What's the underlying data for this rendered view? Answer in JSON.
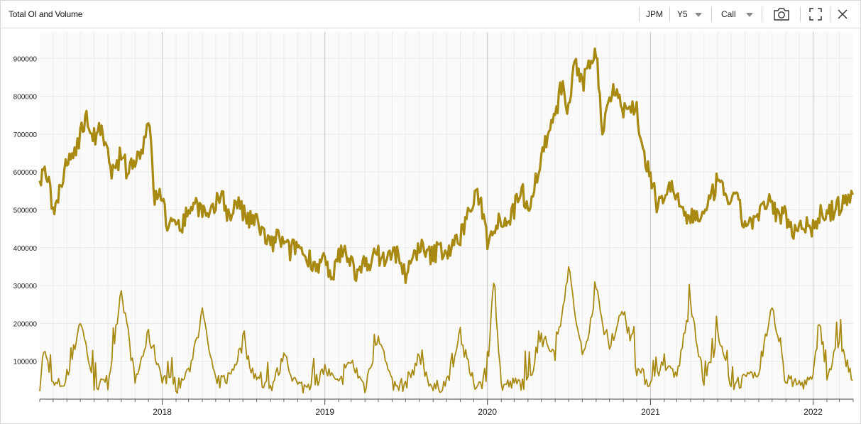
{
  "header": {
    "title": "Total OI and Volume",
    "ticker": "JPM",
    "period": "Y5",
    "option_type": "Call"
  },
  "icons": [
    "camera-icon",
    "fullscreen-icon",
    "close-icon",
    "chevron-down-icon"
  ],
  "colors": {
    "series": "#A88A12",
    "grid": "#ececec",
    "year_line": "#c8c8c8",
    "plot_bg": "#fafafa"
  },
  "chart_data": {
    "type": "line",
    "title": "Total OI and Volume",
    "x_range": [
      "2017-04-01",
      "2022-04-01"
    ],
    "ylim": [
      0,
      970000
    ],
    "y_ticks": [
      100000,
      200000,
      300000,
      400000,
      500000,
      600000,
      700000,
      800000,
      900000
    ],
    "x_tick_labels": [
      "2018",
      "2019",
      "2020",
      "2021",
      "2022"
    ],
    "grid": true,
    "legend": "none",
    "series": [
      {
        "values_oi": [
          [
            "2017-04-01",
            570000
          ],
          [
            "2017-04-15",
            600000
          ],
          [
            "2017-05-01",
            510000
          ],
          [
            "2017-05-15",
            540000
          ],
          [
            "2017-06-01",
            620000
          ],
          [
            "2017-06-15",
            650000
          ],
          [
            "2017-07-01",
            700000
          ],
          [
            "2017-07-15",
            740000
          ],
          [
            "2017-08-01",
            690000
          ],
          [
            "2017-08-15",
            710000
          ],
          [
            "2017-09-01",
            640000
          ],
          [
            "2017-09-15",
            590000
          ],
          [
            "2017-10-01",
            650000
          ],
          [
            "2017-10-15",
            600000
          ],
          [
            "2017-11-01",
            640000
          ],
          [
            "2017-11-15",
            650000
          ],
          [
            "2017-12-01",
            750000
          ],
          [
            "2017-12-15",
            530000
          ],
          [
            "2018-01-01",
            540000
          ],
          [
            "2018-01-15",
            440000
          ],
          [
            "2018-02-01",
            480000
          ],
          [
            "2018-02-15",
            460000
          ],
          [
            "2018-03-01",
            500000
          ],
          [
            "2018-03-15",
            520000
          ],
          [
            "2018-04-01",
            500000
          ],
          [
            "2018-04-15",
            470000
          ],
          [
            "2018-05-01",
            510000
          ],
          [
            "2018-05-15",
            550000
          ],
          [
            "2018-06-01",
            470000
          ],
          [
            "2018-06-15",
            530000
          ],
          [
            "2018-07-01",
            490000
          ],
          [
            "2018-07-15",
            470000
          ],
          [
            "2018-08-01",
            470000
          ],
          [
            "2018-08-15",
            440000
          ],
          [
            "2018-09-01",
            400000
          ],
          [
            "2018-09-15",
            430000
          ],
          [
            "2018-10-01",
            410000
          ],
          [
            "2018-10-15",
            390000
          ],
          [
            "2018-11-01",
            410000
          ],
          [
            "2018-11-15",
            380000
          ],
          [
            "2018-12-01",
            370000
          ],
          [
            "2018-12-15",
            350000
          ],
          [
            "2019-01-01",
            370000
          ],
          [
            "2019-01-15",
            300000
          ],
          [
            "2019-02-01",
            380000
          ],
          [
            "2019-02-15",
            390000
          ],
          [
            "2019-03-01",
            370000
          ],
          [
            "2019-03-15",
            320000
          ],
          [
            "2019-04-01",
            360000
          ],
          [
            "2019-04-15",
            370000
          ],
          [
            "2019-05-01",
            380000
          ],
          [
            "2019-05-15",
            370000
          ],
          [
            "2019-06-01",
            380000
          ],
          [
            "2019-06-15",
            390000
          ],
          [
            "2019-07-01",
            320000
          ],
          [
            "2019-07-15",
            360000
          ],
          [
            "2019-08-01",
            410000
          ],
          [
            "2019-08-15",
            380000
          ],
          [
            "2019-09-01",
            380000
          ],
          [
            "2019-09-15",
            400000
          ],
          [
            "2019-10-01",
            390000
          ],
          [
            "2019-10-15",
            400000
          ],
          [
            "2019-11-01",
            430000
          ],
          [
            "2019-11-15",
            480000
          ],
          [
            "2019-12-01",
            520000
          ],
          [
            "2019-12-15",
            540000
          ],
          [
            "2020-01-01",
            420000
          ],
          [
            "2020-01-15",
            460000
          ],
          [
            "2020-02-01",
            480000
          ],
          [
            "2020-02-15",
            470000
          ],
          [
            "2020-03-01",
            500000
          ],
          [
            "2020-03-15",
            560000
          ],
          [
            "2020-04-01",
            510000
          ],
          [
            "2020-04-15",
            560000
          ],
          [
            "2020-05-01",
            640000
          ],
          [
            "2020-05-15",
            700000
          ],
          [
            "2020-06-01",
            740000
          ],
          [
            "2020-06-15",
            830000
          ],
          [
            "2020-07-01",
            760000
          ],
          [
            "2020-07-15",
            900000
          ],
          [
            "2020-08-01",
            820000
          ],
          [
            "2020-08-15",
            890000
          ],
          [
            "2020-09-01",
            920000
          ],
          [
            "2020-09-15",
            710000
          ],
          [
            "2020-10-01",
            800000
          ],
          [
            "2020-10-15",
            830000
          ],
          [
            "2020-11-01",
            760000
          ],
          [
            "2020-11-15",
            770000
          ],
          [
            "2020-12-01",
            770000
          ],
          [
            "2020-12-15",
            650000
          ],
          [
            "2021-01-01",
            580000
          ],
          [
            "2021-01-15",
            520000
          ],
          [
            "2021-02-01",
            540000
          ],
          [
            "2021-02-15",
            560000
          ],
          [
            "2021-03-01",
            540000
          ],
          [
            "2021-03-15",
            480000
          ],
          [
            "2021-04-01",
            480000
          ],
          [
            "2021-04-15",
            490000
          ],
          [
            "2021-05-01",
            480000
          ],
          [
            "2021-05-15",
            520000
          ],
          [
            "2021-06-01",
            580000
          ],
          [
            "2021-06-15",
            540000
          ],
          [
            "2021-07-01",
            530000
          ],
          [
            "2021-07-15",
            520000
          ],
          [
            "2021-08-01",
            460000
          ],
          [
            "2021-08-15",
            470000
          ],
          [
            "2021-09-01",
            480000
          ],
          [
            "2021-09-15",
            510000
          ],
          [
            "2021-10-01",
            520000
          ],
          [
            "2021-10-15",
            480000
          ],
          [
            "2021-11-01",
            490000
          ],
          [
            "2021-11-15",
            440000
          ],
          [
            "2021-12-01",
            470000
          ],
          [
            "2021-12-15",
            460000
          ],
          [
            "2022-01-01",
            450000
          ],
          [
            "2022-01-15",
            490000
          ],
          [
            "2022-02-01",
            480000
          ],
          [
            "2022-02-15",
            500000
          ],
          [
            "2022-03-01",
            510000
          ],
          [
            "2022-03-15",
            520000
          ],
          [
            "2022-03-31",
            540000
          ]
        ],
        "values_volume": [
          [
            "2017-04-01",
            40000
          ],
          [
            "2017-04-10",
            130000
          ],
          [
            "2017-05-01",
            35000
          ],
          [
            "2017-06-01",
            45000
          ],
          [
            "2017-07-01",
            210000
          ],
          [
            "2017-08-01",
            40000
          ],
          [
            "2017-09-01",
            35000
          ],
          [
            "2017-10-01",
            295000
          ],
          [
            "2017-11-01",
            45000
          ],
          [
            "2017-12-01",
            170000
          ],
          [
            "2018-01-01",
            60000
          ],
          [
            "2018-02-01",
            30000
          ],
          [
            "2018-03-01",
            70000
          ],
          [
            "2018-04-01",
            225000
          ],
          [
            "2018-05-01",
            40000
          ],
          [
            "2018-06-01",
            60000
          ],
          [
            "2018-07-01",
            145000
          ],
          [
            "2018-08-01",
            50000
          ],
          [
            "2018-09-01",
            30000
          ],
          [
            "2018-10-01",
            105000
          ],
          [
            "2018-11-01",
            35000
          ],
          [
            "2018-12-01",
            30000
          ],
          [
            "2019-01-01",
            80000
          ],
          [
            "2019-02-01",
            35000
          ],
          [
            "2019-03-01",
            100000
          ],
          [
            "2019-04-01",
            30000
          ],
          [
            "2019-05-01",
            175000
          ],
          [
            "2019-06-01",
            30000
          ],
          [
            "2019-07-01",
            40000
          ],
          [
            "2019-08-01",
            110000
          ],
          [
            "2019-09-01",
            25000
          ],
          [
            "2019-10-01",
            45000
          ],
          [
            "2019-11-01",
            160000
          ],
          [
            "2019-12-01",
            40000
          ],
          [
            "2020-01-01",
            50000
          ],
          [
            "2020-01-15",
            325000
          ],
          [
            "2020-02-01",
            35000
          ],
          [
            "2020-03-01",
            40000
          ],
          [
            "2020-04-01",
            45000
          ],
          [
            "2020-05-01",
            160000
          ],
          [
            "2020-06-01",
            120000
          ],
          [
            "2020-07-01",
            345000
          ],
          [
            "2020-08-01",
            100000
          ],
          [
            "2020-09-01",
            290000
          ],
          [
            "2020-10-01",
            120000
          ],
          [
            "2020-11-01",
            240000
          ],
          [
            "2020-12-01",
            80000
          ],
          [
            "2021-01-01",
            40000
          ],
          [
            "2021-02-01",
            80000
          ],
          [
            "2021-03-01",
            60000
          ],
          [
            "2021-04-01",
            260000
          ],
          [
            "2021-05-01",
            40000
          ],
          [
            "2021-06-01",
            165000
          ],
          [
            "2021-07-01",
            40000
          ],
          [
            "2021-08-01",
            50000
          ],
          [
            "2021-09-01",
            60000
          ],
          [
            "2021-10-01",
            255000
          ],
          [
            "2021-11-01",
            45000
          ],
          [
            "2021-12-01",
            40000
          ],
          [
            "2022-01-01",
            50000
          ],
          [
            "2022-01-15",
            215000
          ],
          [
            "2022-02-01",
            60000
          ],
          [
            "2022-03-01",
            150000
          ],
          [
            "2022-03-31",
            50000
          ]
        ]
      }
    ]
  }
}
